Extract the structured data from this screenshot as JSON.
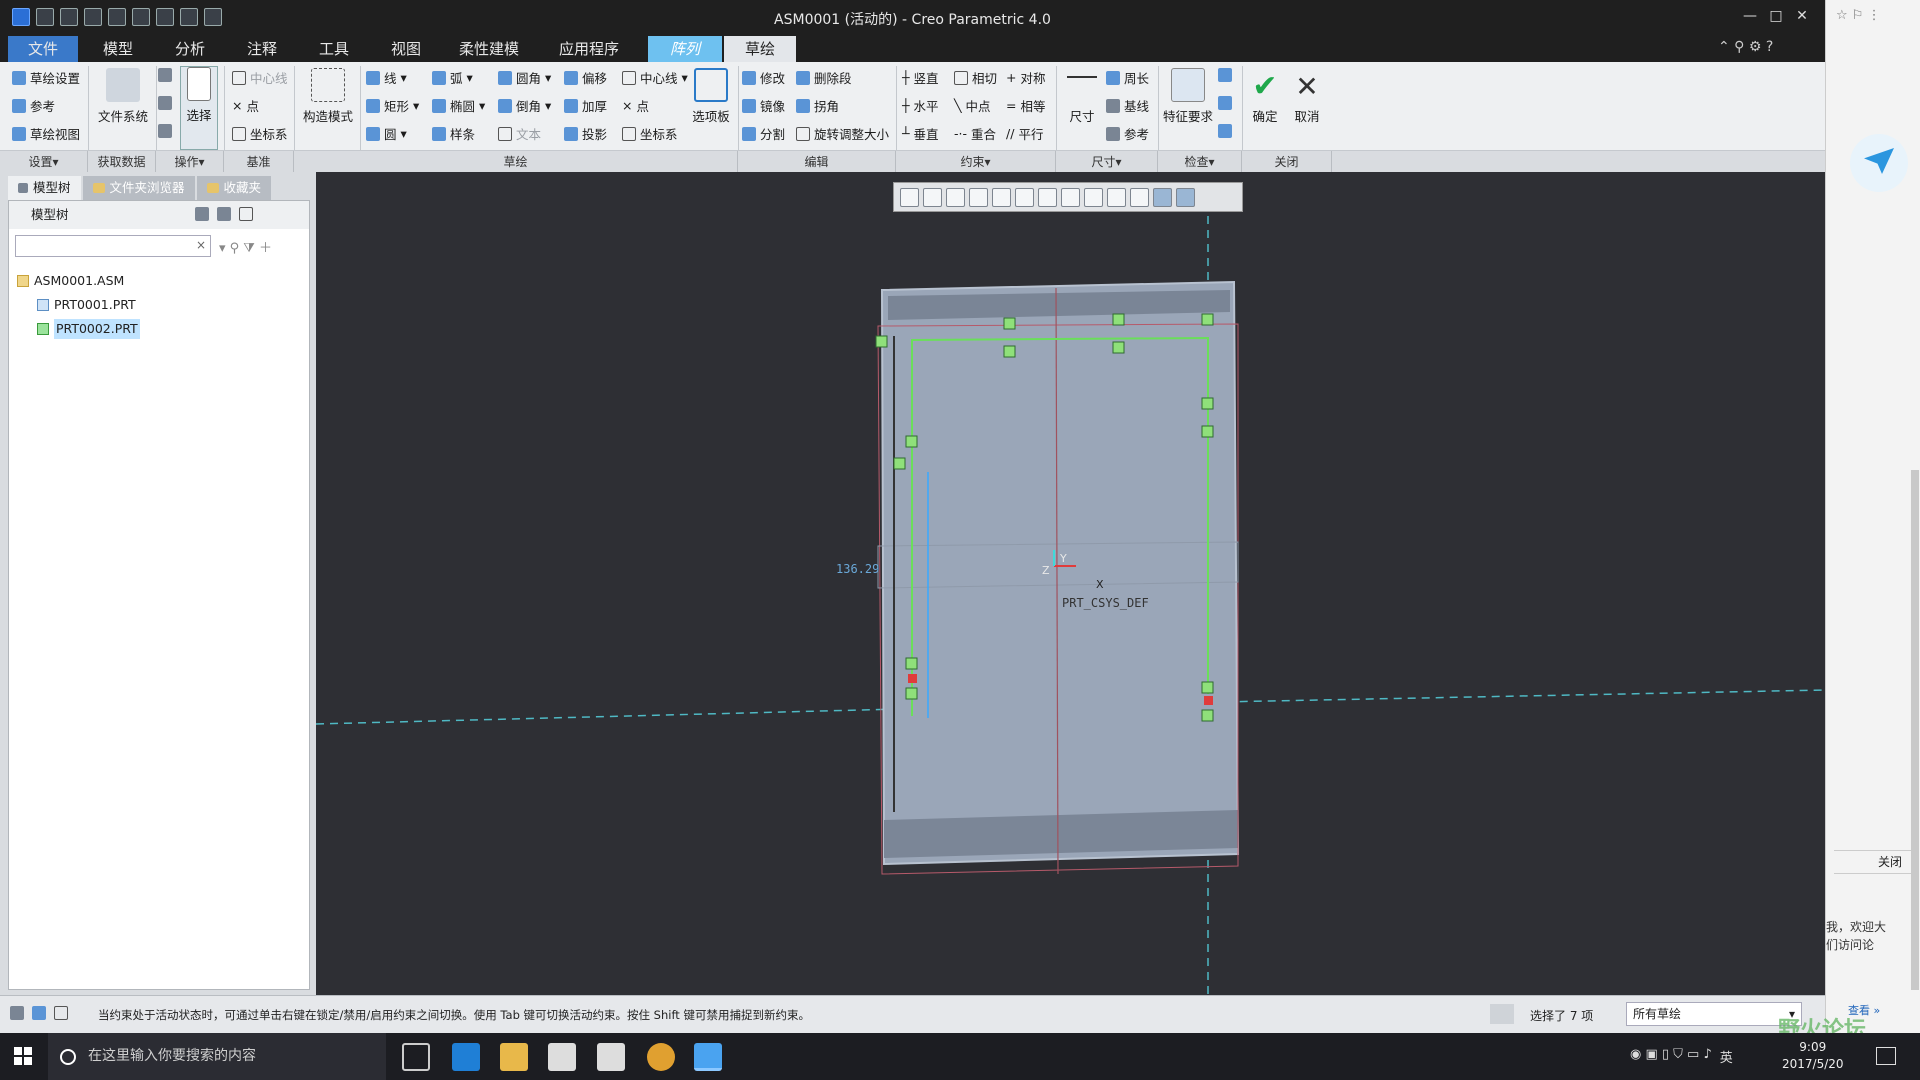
{
  "window": {
    "title": "ASM0001 (活动的) - Creo Parametric 4.0"
  },
  "tabs": [
    "文件",
    "模型",
    "分析",
    "注释",
    "工具",
    "视图",
    "柔性建模",
    "应用程序",
    "阵列",
    "草绘"
  ],
  "ribbon": {
    "setup": [
      "草绘设置",
      "参考",
      "草绘视图"
    ],
    "getdata": "文件系统",
    "select": "选择",
    "datum": [
      "中心线",
      "点",
      "坐标系"
    ],
    "construct": "构造模式",
    "sketch_col1": [
      "线",
      "矩形",
      "圆"
    ],
    "sketch_col2": [
      "弧",
      "椭圆",
      "样条"
    ],
    "sketch_col3": [
      "圆角",
      "倒角",
      "文本"
    ],
    "sketch_col4": [
      "偏移",
      "加厚",
      "投影"
    ],
    "sketch_col5": [
      "中心线",
      "点",
      "坐标系"
    ],
    "palette": "选项板",
    "edit": [
      "修改",
      "删除段",
      "镜像",
      "拐角",
      "分割",
      "旋转调整大小"
    ],
    "constrain_col1": [
      "竖直",
      "水平",
      "垂直"
    ],
    "constrain_col2": [
      "相切",
      "中点",
      "重合"
    ],
    "constrain_col3": [
      "对称",
      "相等",
      "平行"
    ],
    "dimension": "尺寸",
    "dim_col": [
      "周长",
      "基线",
      "参考"
    ],
    "feature_req": "特征要求",
    "ok": "确定",
    "cancel": "取消",
    "groups": [
      "设置",
      "获取数据",
      "操作",
      "基准",
      "草绘",
      "编辑",
      "约束",
      "尺寸",
      "检查",
      "关闭"
    ]
  },
  "leftpanel": {
    "tabs": [
      "模型树",
      "文件夹浏览器",
      "收藏夹"
    ],
    "tree_header": "模型树",
    "items": [
      "ASM0001.ASM",
      "PRT0001.PRT",
      "PRT0002.PRT"
    ]
  },
  "canvas": {
    "csys_label": "PRT_CSYS_DEF",
    "axis_x": "X",
    "axis_y": "Y",
    "axis_z": "Z",
    "dim_value": "136.29"
  },
  "status": {
    "message": "当约束处于活动状态时，可通过单击右键在锁定/禁用/启用约束之间切换。使用 Tab 键可切换活动约束。按住 Shift 键可禁用捕捉到新约束。",
    "selected": "选择了 7 项",
    "filter": "所有草绘"
  },
  "browser": {
    "close": "关闭",
    "text1": "我，欢迎大",
    "text2": "们访问论",
    "more": "查看 »"
  },
  "taskbar": {
    "search_placeholder": "在这里输入你要搜索的内容",
    "time": "9:09",
    "date": "2017/5/20",
    "ime": "英"
  },
  "watermark": "野火论坛"
}
